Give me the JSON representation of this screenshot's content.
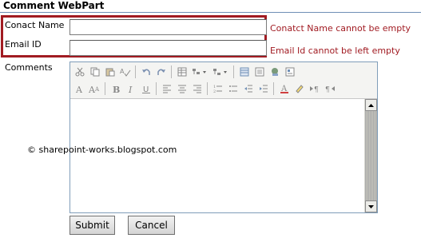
{
  "webpart": {
    "title": "Comment WebPart"
  },
  "form": {
    "contact_name": {
      "label": "Conact Name",
      "value": "",
      "error": "Conatct Name cannot be empty"
    },
    "email": {
      "label": "Email ID",
      "value": "",
      "error": "Email Id cannot be left empty"
    },
    "comments": {
      "label": "Comments",
      "value": ""
    }
  },
  "toolbar": {
    "row1": [
      "cut-icon",
      "copy-icon",
      "paste-icon",
      "spellcheck-icon",
      "undo-icon",
      "redo-icon",
      "table-icon",
      "table-options-icon",
      "list-options-icon",
      "insert-table-icon",
      "show-borders-icon",
      "insert-image-icon",
      "source-icon"
    ],
    "row2": [
      "font-icon",
      "font-size-icon",
      "bold-icon",
      "italic-icon",
      "underline-icon",
      "align-left-icon",
      "align-center-icon",
      "align-right-icon",
      "numbered-list-icon",
      "bulleted-list-icon",
      "decrease-indent-icon",
      "increase-indent-icon",
      "text-color-icon",
      "highlight-icon",
      "ltr-icon",
      "rtl-icon"
    ]
  },
  "watermark": "© sharepoint-works.blogspot.com",
  "buttons": {
    "submit": "Submit",
    "cancel": "Cancel"
  },
  "colors": {
    "error": "#a11b22",
    "rule": "#6f8fb6"
  }
}
